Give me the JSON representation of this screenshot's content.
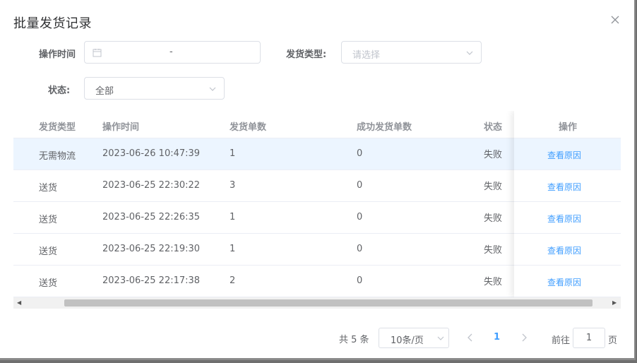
{
  "dialog": {
    "title": "批量发货记录"
  },
  "filters": {
    "op_time_label": "操作时间",
    "date_separator": "-",
    "ship_type_label": "发货类型:",
    "ship_type_placeholder": "请选择",
    "status_label": "状态:",
    "status_value": "全部"
  },
  "table": {
    "headers": [
      "发货类型",
      "操作时间",
      "发货单数",
      "成功发货单数",
      "状态",
      "操作"
    ],
    "rows": [
      {
        "type": "无需物流",
        "time": "2023-06-26 10:47:39",
        "count": "1",
        "success": "0",
        "status": "失败",
        "action": "查看原因"
      },
      {
        "type": "送货",
        "time": "2023-06-25 22:30:22",
        "count": "3",
        "success": "0",
        "status": "失败",
        "action": "查看原因"
      },
      {
        "type": "送货",
        "time": "2023-06-25 22:26:35",
        "count": "1",
        "success": "0",
        "status": "失败",
        "action": "查看原因"
      },
      {
        "type": "送货",
        "time": "2023-06-25 22:19:30",
        "count": "1",
        "success": "0",
        "status": "失败",
        "action": "查看原因"
      },
      {
        "type": "送货",
        "time": "2023-06-25 22:17:38",
        "count": "2",
        "success": "0",
        "status": "失败",
        "action": "查看原因"
      }
    ]
  },
  "pagination": {
    "total": "共 5 条",
    "page_size": "10条/页",
    "current_page": "1",
    "goto_label": "前往",
    "goto_value": "1",
    "page_suffix": "页"
  },
  "colors": {
    "accent": "#409eff",
    "row_highlight": "#ecf5ff"
  }
}
